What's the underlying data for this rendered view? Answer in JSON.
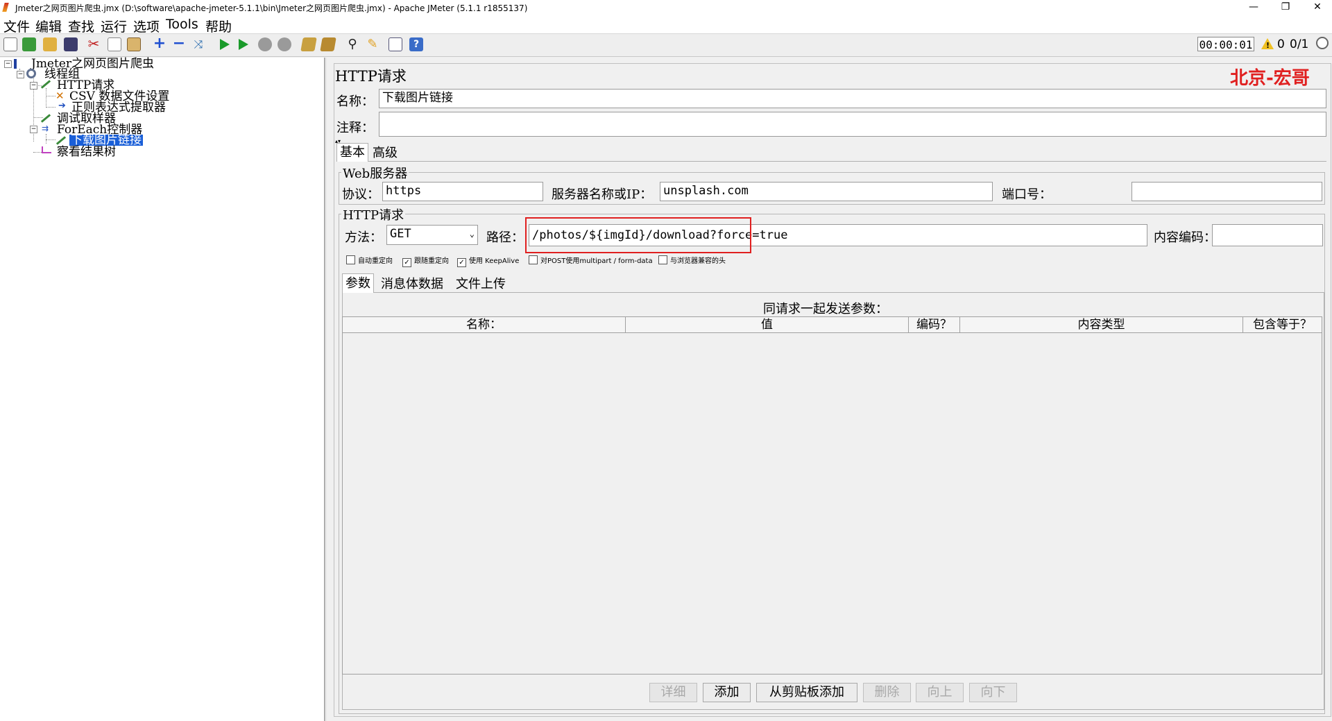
{
  "window": {
    "title": "Jmeter之网页图片爬虫.jmx (D:\\software\\apache-jmeter-5.1.1\\bin\\Jmeter之网页图片爬虫.jmx) - Apache JMeter (5.1.1 r1855137)",
    "minimize": "—",
    "restore": "❐",
    "close": "✕"
  },
  "menu": [
    "文件",
    "编辑",
    "查找",
    "运行",
    "选项",
    "Tools",
    "帮助"
  ],
  "toolbar": {
    "timer": "00:00:01",
    "warn_count": "0",
    "threads": "0/1",
    "icons": [
      "new-icon",
      "templates-icon",
      "open-icon",
      "save-icon",
      "cut-icon",
      "copy-icon",
      "paste-icon",
      "expand-icon",
      "collapse-icon",
      "toggle-icon",
      "start-icon",
      "start-no-pause-icon",
      "stop-icon",
      "shutdown-icon",
      "clear-icon",
      "clear-all-icon",
      "search-icon",
      "reset-search-icon",
      "function-helper-icon",
      "help-icon"
    ]
  },
  "tree": {
    "root": "Jmeter之网页图片爬虫",
    "thread_group": "线程组",
    "http_request": "HTTP请求",
    "csv": "CSV 数据文件设置",
    "regex": "正则表达式提取器",
    "debug_sampler": "调试取样器",
    "foreach": "ForEach控制器",
    "download": "下载图片链接",
    "results_tree": "察看结果树"
  },
  "panel": {
    "title": "HTTP请求",
    "watermark": "北京-宏哥",
    "name_label": "名称：",
    "name_value": "下载图片链接",
    "comment_label": "注释：",
    "comment_value": "",
    "tabs": [
      "基本",
      "高级"
    ],
    "web_server": {
      "legend": "Web服务器",
      "protocol_label": "协议：",
      "protocol_value": "https",
      "server_label": "服务器名称或IP：",
      "server_value": "unsplash.com",
      "port_label": "端口号：",
      "port_value": ""
    },
    "http": {
      "legend": "HTTP请求",
      "method_label": "方法：",
      "method_value": "GET",
      "path_label": "路径：",
      "path_value": "/photos/${imgId}/download?force=true",
      "encoding_label": "内容编码：",
      "encoding_value": ""
    },
    "options": [
      {
        "label": "自动重定向",
        "checked": false
      },
      {
        "label": "跟随重定向",
        "checked": true
      },
      {
        "label": "使用 KeepAlive",
        "checked": true
      },
      {
        "label": "对POST使用multipart / form-data",
        "checked": false
      },
      {
        "label": "与浏览器兼容的头",
        "checked": false
      }
    ],
    "param_tabs": [
      "参数",
      "消息体数据",
      "文件上传"
    ],
    "params_caption": "同请求一起发送参数：",
    "columns": [
      "名称：",
      "值",
      "编码？",
      "内容类型",
      "包含等于？"
    ],
    "buttons": {
      "detail": "详细",
      "add": "添加",
      "add_clipboard": "从剪贴板添加",
      "delete": "删除",
      "up": "向上",
      "down": "向下"
    },
    "highlight_color": "#e02020"
  }
}
